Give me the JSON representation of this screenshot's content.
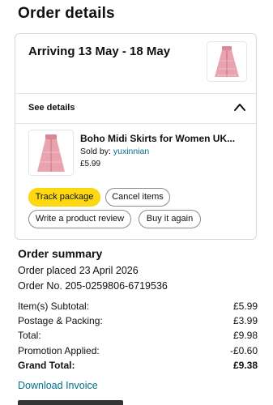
{
  "page": {
    "title": "Order details"
  },
  "shipment": {
    "arriving": "Arriving 13 May - 18 May",
    "see_details": "See details"
  },
  "item": {
    "title": "Boho Midi Skirts for Women UK...",
    "sold_by_label": "Sold by:",
    "seller": "yuxinnian",
    "price": "£5.99"
  },
  "actions": {
    "track": "Track package",
    "cancel": "Cancel items",
    "review": "Write a product review",
    "buy_again": "Buy it again"
  },
  "summary": {
    "title": "Order summary",
    "placed": "Order placed 23 April 2026",
    "order_no": "Order No. 205-0259806-6719536",
    "rows": [
      {
        "label": "Item(s) Subtotal:",
        "value": "£5.99"
      },
      {
        "label": "Postage & Packing:",
        "value": "£3.99"
      },
      {
        "label": "Total:",
        "value": "£9.98"
      },
      {
        "label": "Promotion Applied:",
        "value": "-£0.60"
      },
      {
        "label": "Grand Total:",
        "value": "£9.38"
      }
    ],
    "download": "Download Invoice"
  },
  "colors": {
    "primary_button": "#ffd814",
    "link": "#007185",
    "border": "#d5d9d9",
    "product_pink": "#e59aa6"
  },
  "icons": {
    "chevron": "chevron-up-icon",
    "product": "skirt-product-image"
  }
}
